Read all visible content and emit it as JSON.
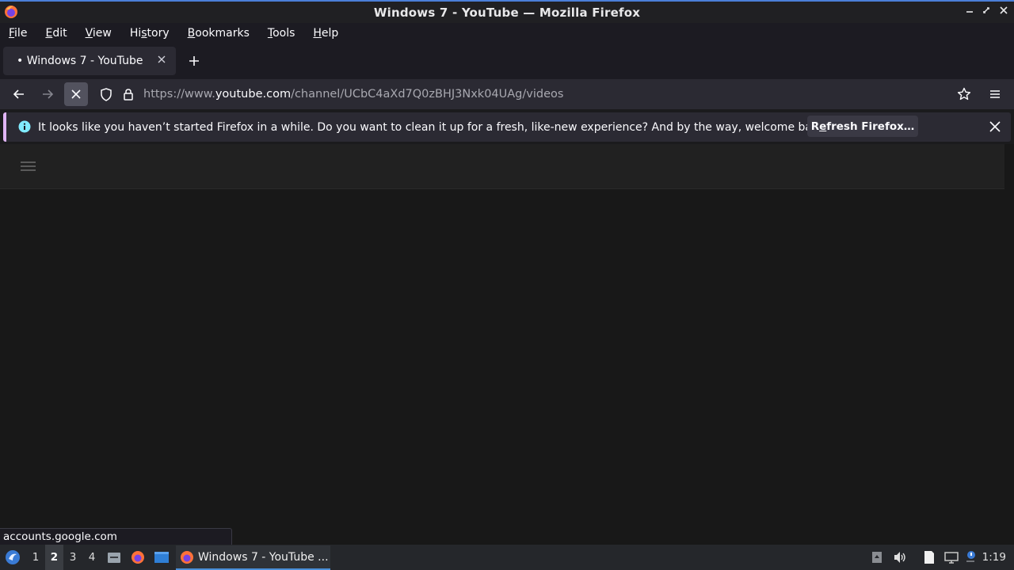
{
  "window": {
    "title": "Windows 7 - YouTube — Mozilla Firefox",
    "controls": [
      "minimize",
      "maximize",
      "close"
    ]
  },
  "menubar": {
    "items": [
      {
        "label": "File",
        "accel": "F",
        "rest": "ile"
      },
      {
        "label": "Edit",
        "accel": "E",
        "rest": "dit"
      },
      {
        "label": "View",
        "accel": "V",
        "rest": "iew"
      },
      {
        "label": "History",
        "pre": "Hi",
        "accel": "s",
        "rest": "tory"
      },
      {
        "label": "Bookmarks",
        "accel": "B",
        "rest": "ookmarks"
      },
      {
        "label": "Tools",
        "accel": "T",
        "rest": "ools"
      },
      {
        "label": "Help",
        "accel": "H",
        "rest": "elp"
      }
    ]
  },
  "tabs": [
    {
      "title": "• Windows 7 - YouTube",
      "active": true
    }
  ],
  "navbar": {
    "url_prefix": "https://www.",
    "url_host": "youtube.com",
    "url_path": "/channel/UCbC4aXd7Q0zBHJ3Nxk04UAg/videos"
  },
  "notification": {
    "message": "It looks like you haven’t started Firefox in a while. Do you want to clean it up for a fresh, like-new experience? And by the way, welcome back!",
    "button_pre": "R",
    "button_accel": "e",
    "button_rest": "fresh Firefox…",
    "accent": "#e0b5f5"
  },
  "status": {
    "text": "accounts.google.com"
  },
  "taskbar": {
    "workspaces": [
      "1",
      "2",
      "3",
      "4"
    ],
    "active_workspace": "2",
    "task_label": "Windows 7 - YouTube ...",
    "clock": "1:19"
  }
}
